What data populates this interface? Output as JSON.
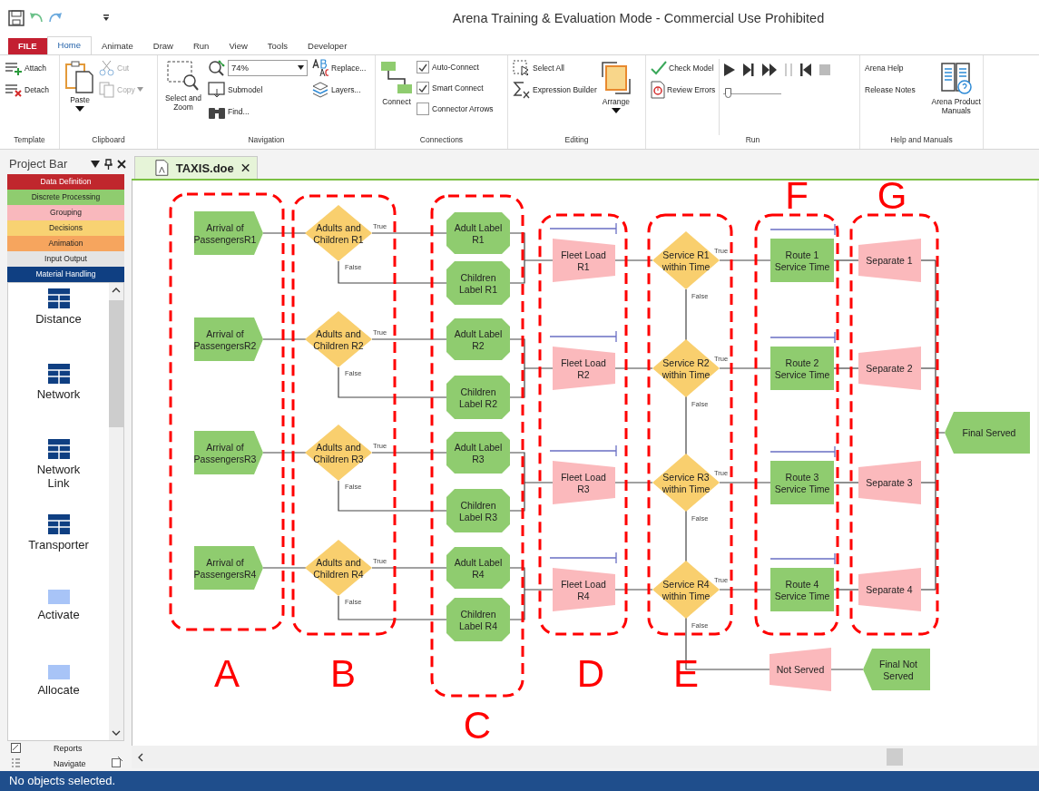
{
  "title_bar": {
    "title": "Arena Training & Evaluation Mode - Commercial Use Prohibited"
  },
  "ribbon": {
    "tabs": [
      {
        "label": "FILE",
        "kind": "file",
        "selected": false
      },
      {
        "label": "Home",
        "kind": "tab",
        "selected": true
      },
      {
        "label": "Animate",
        "kind": "tab",
        "selected": false
      },
      {
        "label": "Draw",
        "kind": "tab",
        "selected": false
      },
      {
        "label": "Run",
        "kind": "tab",
        "selected": false
      },
      {
        "label": "View",
        "kind": "tab",
        "selected": false
      },
      {
        "label": "Tools",
        "kind": "tab",
        "selected": false
      },
      {
        "label": "Developer",
        "kind": "tab",
        "selected": false
      }
    ],
    "template": {
      "name": "Template",
      "attach": "Attach",
      "detach": "Detach"
    },
    "clipboard": {
      "name": "Clipboard",
      "paste": "Paste",
      "cut": {
        "label": "Cut",
        "disabled": true
      },
      "copy": {
        "label": "Copy",
        "disabled": true
      }
    },
    "navigation": {
      "name": "Navigation",
      "select_zoom": "Select and Zoom",
      "zoom": "74%",
      "submodel": "Submodel",
      "find": "Find...",
      "replace": "Replace...",
      "layers": "Layers..."
    },
    "connections": {
      "name": "Connections",
      "connect": "Connect",
      "options": [
        {
          "label": "Auto-Connect",
          "checked": true
        },
        {
          "label": "Smart Connect",
          "checked": true
        },
        {
          "label": "Connector Arrows",
          "checked": false
        }
      ]
    },
    "editing": {
      "name": "Editing",
      "select_all": "Select All",
      "expression_builder": "Expression Builder",
      "arrange": "Arrange"
    },
    "run": {
      "name": "Run",
      "check_model": "Check Model",
      "review_errors": "Review Errors",
      "speed": {
        "level": 0.03
      }
    },
    "help": {
      "name": "Help and Manuals",
      "arena_help": "Arena Help",
      "release_notes": "Release Notes",
      "manuals": "Arena Product Manuals"
    }
  },
  "project_bar": {
    "title": "Project Bar",
    "panels": [
      {
        "label": "Data Definition",
        "color": "#c0272d"
      },
      {
        "label": "Discrete Processing",
        "color": "#8fcc6f"
      },
      {
        "label": "Grouping",
        "color": "#f9b8bd"
      },
      {
        "label": "Decisions",
        "color": "#f8d272"
      },
      {
        "label": "Animation",
        "color": "#f6a55e"
      },
      {
        "label": "Input Output",
        "color": "#e4e4e4"
      },
      {
        "label": "Material Handling",
        "color": "#0f3f82"
      }
    ],
    "items": [
      {
        "label": "Distance",
        "kind": "table"
      },
      {
        "label": "Network",
        "kind": "table"
      },
      {
        "label": "Network Link",
        "kind": "table"
      },
      {
        "label": "Transporter",
        "kind": "table"
      },
      {
        "label": "Activate",
        "kind": "block"
      },
      {
        "label": "Allocate",
        "kind": "block"
      }
    ],
    "footer": [
      {
        "label": "Reports",
        "kind": "reports"
      },
      {
        "label": "Navigate",
        "kind": "navigate"
      }
    ]
  },
  "document_tab": {
    "label": "TAXIS.doe"
  },
  "diagram": {
    "groups": [
      {
        "letter": "A"
      },
      {
        "letter": "B"
      },
      {
        "letter": "C"
      },
      {
        "letter": "D"
      },
      {
        "letter": "E"
      },
      {
        "letter": "F"
      },
      {
        "letter": "G"
      }
    ],
    "rows": [
      {
        "arrival": [
          "Arrival of",
          "PassengersR1"
        ],
        "decision": [
          "Adults and",
          "Children R1"
        ],
        "true_label": "True",
        "false_label": "False",
        "adult": [
          "Adult Label",
          "R1"
        ],
        "children": [
          "Children",
          "Label R1"
        ],
        "fleet": [
          "Fleet Load",
          "R1"
        ],
        "service": [
          "Service R1",
          "within Time"
        ],
        "service_true": "True",
        "service_false": "False",
        "route": [
          "Route 1",
          "Service Time"
        ],
        "separate": [
          "Separate 1"
        ]
      },
      {
        "arrival": [
          "Arrival of",
          "PassengersR2"
        ],
        "decision": [
          "Adults and",
          "Children R2"
        ],
        "true_label": "True",
        "false_label": "False",
        "adult": [
          "Adult Label",
          "R2"
        ],
        "children": [
          "Children",
          "Label R2"
        ],
        "fleet": [
          "Fleet Load",
          "R2"
        ],
        "service": [
          "Service R2",
          "within Time"
        ],
        "service_true": "True",
        "service_false": "False",
        "route": [
          "Route 2",
          "Service Time"
        ],
        "separate": [
          "Separate 2"
        ]
      },
      {
        "arrival": [
          "Arrival of",
          "PassengersR3"
        ],
        "decision": [
          "Adults and",
          "Children R3"
        ],
        "true_label": "True",
        "false_label": "False",
        "adult": [
          "Adult Label",
          "R3"
        ],
        "children": [
          "Children",
          "Label R3"
        ],
        "fleet": [
          "Fleet Load",
          "R3"
        ],
        "service": [
          "Service R3",
          "within Time"
        ],
        "service_true": "True",
        "service_false": "False",
        "route": [
          "Route 3",
          "Service Time"
        ],
        "separate": [
          "Separate 3"
        ]
      },
      {
        "arrival": [
          "Arrival of",
          "PassengersR4"
        ],
        "decision": [
          "Adults and",
          "Children R4"
        ],
        "true_label": "True",
        "false_label": "False",
        "adult": [
          "Adult Label",
          "R4"
        ],
        "children": [
          "Children",
          "Label R4"
        ],
        "fleet": [
          "Fleet Load",
          "R4"
        ],
        "service": [
          "Service R4",
          "within Time"
        ],
        "service_true": "True",
        "service_false": "False",
        "route": [
          "Route 4",
          "Service Time"
        ],
        "separate": [
          "Separate 4"
        ]
      }
    ],
    "final_served": [
      "Final Served"
    ],
    "not_served": [
      "Not Served"
    ],
    "final_not_served": [
      "Final Not",
      "Served"
    ]
  },
  "status_bar": {
    "text": "No objects selected."
  }
}
